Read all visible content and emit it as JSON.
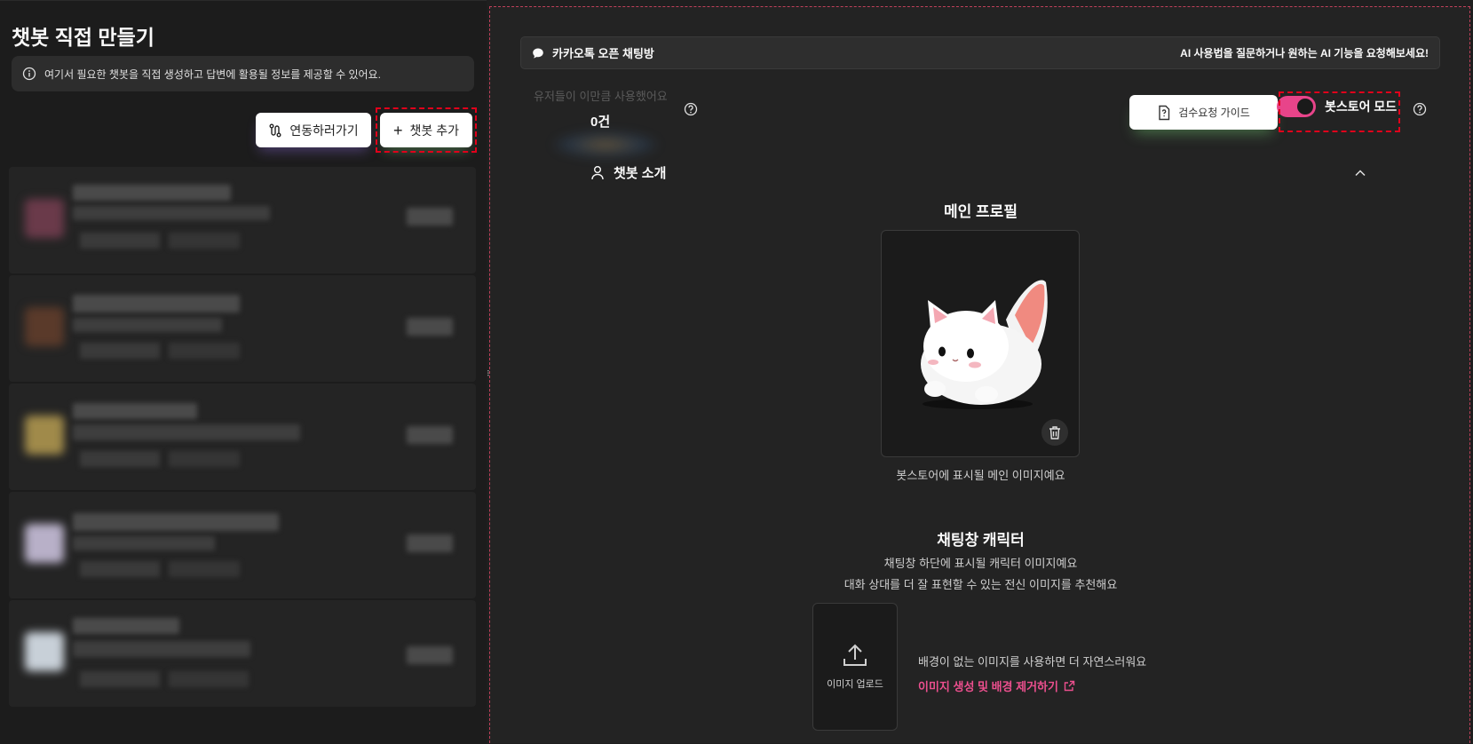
{
  "left": {
    "title": "챗봇 직접 만들기",
    "info_text": "여기서 필요한 챗봇을 직접 생성하고 답변에 활용될 정보를 제공할 수 있어요.",
    "link_button": "연동하러가기",
    "add_button": "챗봇 추가",
    "bot_items": [
      {
        "avatar_color": "#6a3a4a"
      },
      {
        "avatar_color": "#5a3a2a"
      },
      {
        "avatar_color": "#a08a4a"
      },
      {
        "avatar_color": "#b8b0c8"
      },
      {
        "avatar_color": "#c8d0d8"
      }
    ]
  },
  "right": {
    "banner": {
      "title": "카카오톡 오픈 채팅방",
      "cta": "AI 사용법을 질문하거나 원하는 AI 기능을 요청해보세요!"
    },
    "usage": {
      "label": "유저들이 이만큼 사용했어요",
      "count": "0건"
    },
    "guide_button": "검수요청 가이드",
    "botstore_mode": {
      "label": "봇스토어 모드",
      "enabled": true
    },
    "section": {
      "title": "챗봇 소개"
    },
    "main_profile": {
      "heading": "메인 프로필",
      "caption": "봇스토어에 표시될 메인 이미지예요"
    },
    "chat_character": {
      "heading": "채팅창 캐릭터",
      "desc1": "채팅창 하단에 표시될 캐릭터 이미지예요",
      "desc2": "대화 상대를 더 잘 표현할 수 있는 전신 이미지를 추천해요",
      "upload_label": "이미지 업로드",
      "hint": "배경이 없는 이미지를 사용하면 더 자연스러워요",
      "link": "이미지 생성 및 배경 제거하기"
    }
  },
  "colors": {
    "accent_pink": "#ec4f8e",
    "toggle_on": "#e8448a",
    "highlight_dash": "#e0001b"
  }
}
